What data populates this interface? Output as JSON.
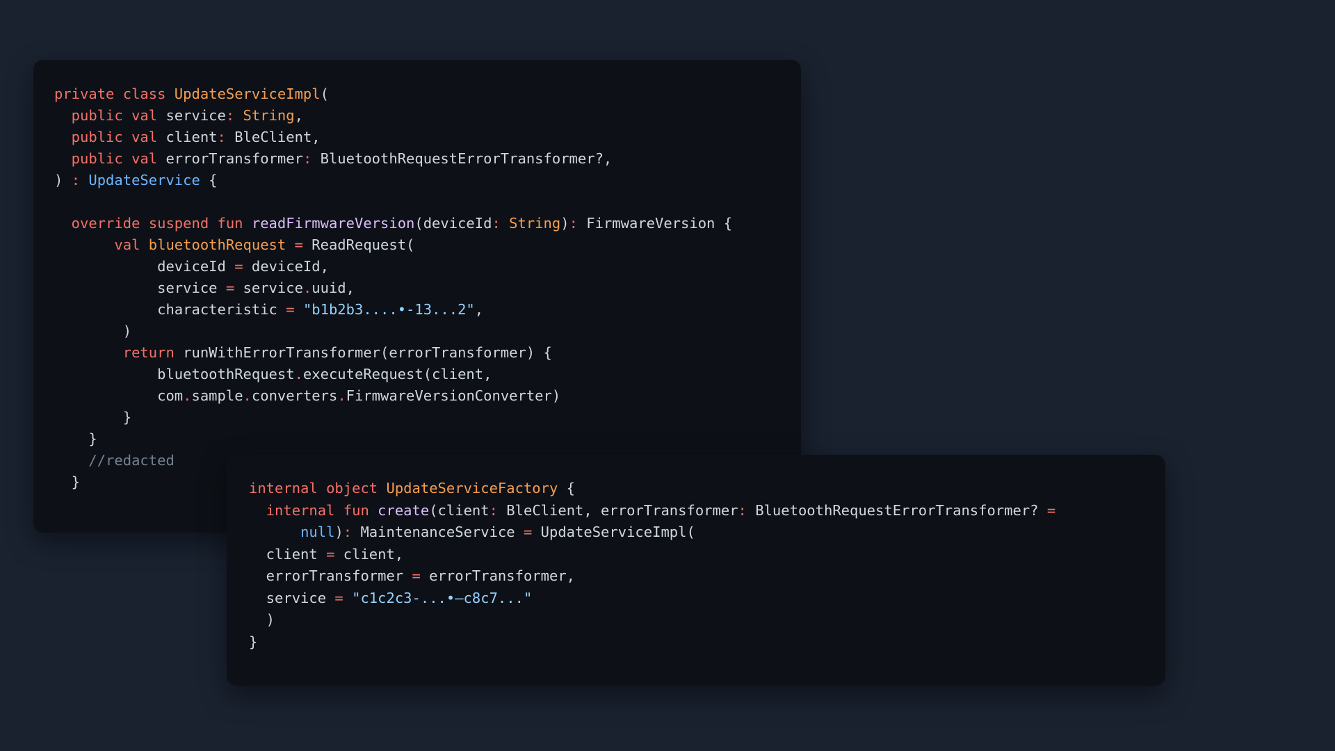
{
  "panel_main": {
    "lines": [
      [
        {
          "t": "private class ",
          "c": "kw"
        },
        {
          "t": "UpdateServiceImpl",
          "c": "ty"
        },
        {
          "t": "(",
          "c": ""
        }
      ],
      [
        {
          "t": "  public val ",
          "c": "kw"
        },
        {
          "t": "service",
          "c": ""
        },
        {
          "t": ": ",
          "c": "kw"
        },
        {
          "t": "String",
          "c": "ty"
        },
        {
          "t": ",",
          "c": ""
        }
      ],
      [
        {
          "t": "  public val ",
          "c": "kw"
        },
        {
          "t": "client",
          "c": ""
        },
        {
          "t": ": ",
          "c": "kw"
        },
        {
          "t": "BleClient,",
          "c": ""
        }
      ],
      [
        {
          "t": "  public val ",
          "c": "kw"
        },
        {
          "t": "errorTransformer",
          "c": ""
        },
        {
          "t": ": ",
          "c": "kw"
        },
        {
          "t": "BluetoothRequestErrorTransformer?,",
          "c": ""
        }
      ],
      [
        {
          "t": ") ",
          "c": ""
        },
        {
          "t": ": ",
          "c": "kw"
        },
        {
          "t": "UpdateService",
          "c": "in"
        },
        {
          "t": " {",
          "c": ""
        }
      ],
      [],
      [
        {
          "t": "  override suspend fun ",
          "c": "kw"
        },
        {
          "t": "readFirmwareVersion",
          "c": "fn"
        },
        {
          "t": "(deviceId",
          "c": ""
        },
        {
          "t": ": ",
          "c": "kw"
        },
        {
          "t": "String",
          "c": "ty"
        },
        {
          "t": ")",
          "c": ""
        },
        {
          "t": ": ",
          "c": "kw"
        },
        {
          "t": "FirmwareVersion {",
          "c": ""
        }
      ],
      [
        {
          "t": "       val ",
          "c": "kw"
        },
        {
          "t": "bluetoothRequest",
          "c": "ty"
        },
        {
          "t": " = ",
          "c": "kw"
        },
        {
          "t": "ReadRequest(",
          "c": ""
        }
      ],
      [
        {
          "t": "            deviceId ",
          "c": ""
        },
        {
          "t": "=",
          "c": "kw"
        },
        {
          "t": " deviceId,",
          "c": ""
        }
      ],
      [
        {
          "t": "            service ",
          "c": ""
        },
        {
          "t": "=",
          "c": "kw"
        },
        {
          "t": " service",
          "c": ""
        },
        {
          "t": ".",
          "c": "kw"
        },
        {
          "t": "uuid,",
          "c": ""
        }
      ],
      [
        {
          "t": "            characteristic ",
          "c": ""
        },
        {
          "t": "=",
          "c": "kw"
        },
        {
          "t": " ",
          "c": ""
        },
        {
          "t": "\"b1b2b3....•-13...2\"",
          "c": "st"
        },
        {
          "t": ",",
          "c": ""
        }
      ],
      [
        {
          "t": "        )",
          "c": ""
        }
      ],
      [
        {
          "t": "        return ",
          "c": "kw"
        },
        {
          "t": "runWithErrorTransformer(errorTransformer) {",
          "c": ""
        }
      ],
      [
        {
          "t": "            bluetoothRequest",
          "c": ""
        },
        {
          "t": ".",
          "c": "kw"
        },
        {
          "t": "executeRequest(client,",
          "c": ""
        }
      ],
      [
        {
          "t": "            com",
          "c": ""
        },
        {
          "t": ".",
          "c": "kw"
        },
        {
          "t": "sample",
          "c": ""
        },
        {
          "t": ".",
          "c": "kw"
        },
        {
          "t": "converters",
          "c": ""
        },
        {
          "t": ".",
          "c": "kw"
        },
        {
          "t": "FirmwareVersionConverter)",
          "c": ""
        }
      ],
      [
        {
          "t": "        }",
          "c": ""
        }
      ],
      [
        {
          "t": "    }",
          "c": ""
        }
      ],
      [
        {
          "t": "    //redacted",
          "c": "cm"
        }
      ],
      [
        {
          "t": "  }",
          "c": ""
        }
      ]
    ]
  },
  "panel_factory": {
    "lines": [
      [
        {
          "t": "internal object ",
          "c": "kw"
        },
        {
          "t": "UpdateServiceFactory",
          "c": "ty"
        },
        {
          "t": " {",
          "c": ""
        }
      ],
      [
        {
          "t": "  internal fun ",
          "c": "kw"
        },
        {
          "t": "create",
          "c": "fn"
        },
        {
          "t": "(client",
          "c": ""
        },
        {
          "t": ": ",
          "c": "kw"
        },
        {
          "t": "BleClient, errorTransformer",
          "c": ""
        },
        {
          "t": ": ",
          "c": "kw"
        },
        {
          "t": "BluetoothRequestErrorTransformer? ",
          "c": ""
        },
        {
          "t": "=",
          "c": "kw"
        }
      ],
      [
        {
          "t": "      ",
          "c": ""
        },
        {
          "t": "null",
          "c": "in"
        },
        {
          "t": ")",
          "c": ""
        },
        {
          "t": ": ",
          "c": "kw"
        },
        {
          "t": "MaintenanceService ",
          "c": ""
        },
        {
          "t": "=",
          "c": "kw"
        },
        {
          "t": " UpdateServiceImpl(",
          "c": ""
        }
      ],
      [
        {
          "t": "  client ",
          "c": ""
        },
        {
          "t": "=",
          "c": "kw"
        },
        {
          "t": " client,",
          "c": ""
        }
      ],
      [
        {
          "t": "  errorTransformer ",
          "c": ""
        },
        {
          "t": "=",
          "c": "kw"
        },
        {
          "t": " errorTransformer,",
          "c": ""
        }
      ],
      [
        {
          "t": "  service ",
          "c": ""
        },
        {
          "t": "=",
          "c": "kw"
        },
        {
          "t": " ",
          "c": ""
        },
        {
          "t": "\"c1c2c3-...•—c8c7...\"",
          "c": "st"
        }
      ],
      [
        {
          "t": "  )",
          "c": ""
        }
      ],
      [
        {
          "t": "}",
          "c": ""
        }
      ]
    ]
  }
}
